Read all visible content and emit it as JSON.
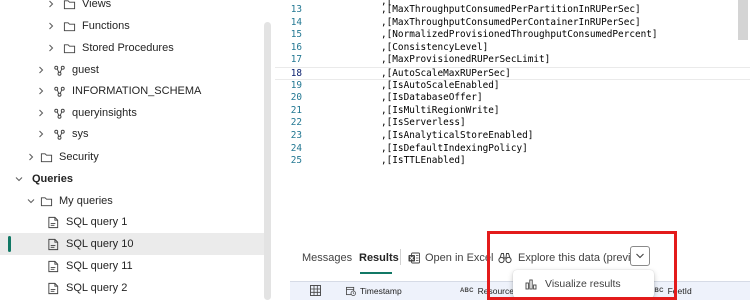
{
  "tree": {
    "items": [
      {
        "label": "Views",
        "type": "folder",
        "chevron": "right"
      },
      {
        "label": "Functions",
        "type": "folder",
        "chevron": "right"
      },
      {
        "label": "Stored Procedures",
        "type": "folder",
        "chevron": "right"
      },
      {
        "label": "guest",
        "type": "schema",
        "chevron": "right"
      },
      {
        "label": "INFORMATION_SCHEMA",
        "type": "schema",
        "chevron": "right"
      },
      {
        "label": "queryinsights",
        "type": "schema",
        "chevron": "right"
      },
      {
        "label": "sys",
        "type": "schema",
        "chevron": "right"
      },
      {
        "label": "Security",
        "type": "folder",
        "chevron": "right"
      },
      {
        "label": "Queries",
        "type": "section",
        "chevron": "down"
      },
      {
        "label": "My queries",
        "type": "folder",
        "chevron": "down"
      },
      {
        "label": "SQL query 1",
        "type": "query"
      },
      {
        "label": "SQL query 10",
        "type": "query",
        "selected": true
      },
      {
        "label": "SQL query 11",
        "type": "query"
      },
      {
        "label": "SQL query 2",
        "type": "query"
      }
    ]
  },
  "editor": {
    "lines": [
      {
        "num": "13",
        "code": ",[MaxThroughputConsumedPerPartitionInRUPerSec]"
      },
      {
        "num": "14",
        "code": ",[MaxThroughputConsumedPerContainerInRUPerSec]"
      },
      {
        "num": "15",
        "code": ",[NormalizedProvisionedThroughputConsumedPercent]"
      },
      {
        "num": "16",
        "code": ",[ConsistencyLevel]"
      },
      {
        "num": "17",
        "code": ",[MaxProvisionedRUPerSecLimit]"
      },
      {
        "num": "18",
        "code": ",[AutoScaleMaxRUPerSec]",
        "active": true
      },
      {
        "num": "19",
        "code": ",[IsAutoScaleEnabled]"
      },
      {
        "num": "20",
        "code": ",[IsDatabaseOffer]"
      },
      {
        "num": "21",
        "code": ",[IsMultiRegionWrite]"
      },
      {
        "num": "22",
        "code": ",[IsServerless]"
      },
      {
        "num": "23",
        "code": ",[IsAnalyticalStoreEnabled]"
      },
      {
        "num": "24",
        "code": ",[IsDefaultIndexingPolicy]"
      },
      {
        "num": "25",
        "code": ",[IsTTLEnabled]"
      }
    ]
  },
  "results_tabs": {
    "messages": "Messages",
    "results": "Results",
    "open_in_excel": "Open in Excel",
    "explore": "Explore this data (preview)"
  },
  "dropdown": {
    "visualize": "Visualize results"
  },
  "grid": {
    "abc_tag": "ABC",
    "columns": [
      "Timestamp",
      "Resourcel",
      "FeetId"
    ]
  },
  "colors": {
    "accent": "#117865",
    "highlight": "#e31b1b",
    "folder_stroke": "#424242",
    "line_number": "#237893"
  }
}
